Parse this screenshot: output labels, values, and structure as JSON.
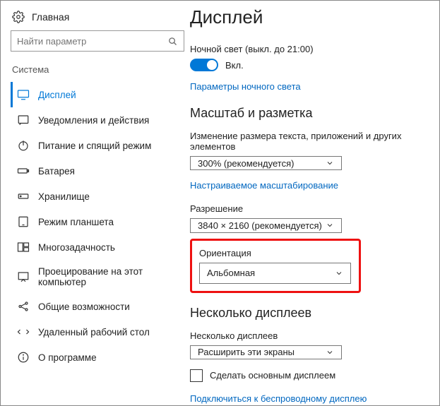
{
  "sidebar": {
    "home": "Главная",
    "search_placeholder": "Найти параметр",
    "section": "Система",
    "items": [
      {
        "label": "Дисплей"
      },
      {
        "label": "Уведомления и действия"
      },
      {
        "label": "Питание и спящий режим"
      },
      {
        "label": "Батарея"
      },
      {
        "label": "Хранилище"
      },
      {
        "label": "Режим планшета"
      },
      {
        "label": "Многозадачность"
      },
      {
        "label": "Проецирование на этот компьютер"
      },
      {
        "label": "Общие возможности"
      },
      {
        "label": "Удаленный рабочий стол"
      },
      {
        "label": "О программе"
      }
    ]
  },
  "main": {
    "title": "Дисплей",
    "night_light": {
      "label": "Ночной свет (выкл. до 21:00)",
      "state": "Вкл.",
      "link": "Параметры ночного света"
    },
    "scale": {
      "heading": "Масштаб и разметка",
      "size_label": "Изменение размера текста, приложений и других элементов",
      "size_value": "300% (рекомендуется)",
      "custom_link": "Настраиваемое масштабирование",
      "res_label": "Разрешение",
      "res_value": "3840 × 2160 (рекомендуется)",
      "orient_label": "Ориентация",
      "orient_value": "Альбомная"
    },
    "multi": {
      "heading": "Несколько дисплеев",
      "label": "Несколько дисплеев",
      "value": "Расширить эти экраны",
      "checkbox": "Сделать основным дисплеем",
      "wireless_link": "Подключиться к беспроводному дисплею"
    }
  }
}
